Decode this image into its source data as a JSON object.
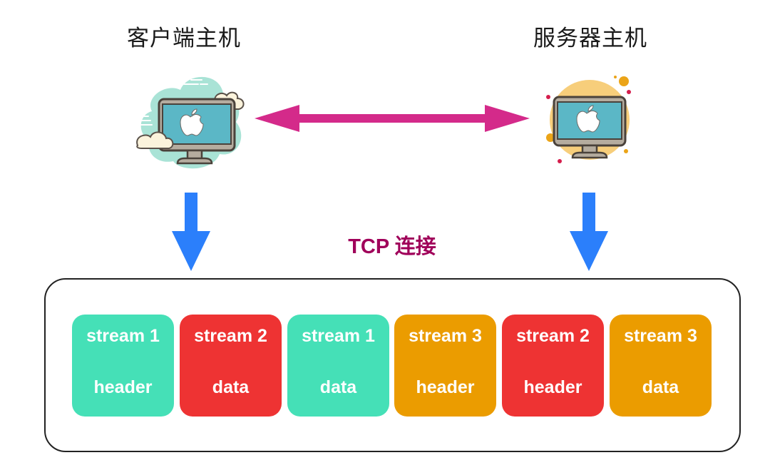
{
  "client": {
    "title": "客户端主机",
    "icon": "client-computer-cloud-icon"
  },
  "server": {
    "title": "服务器主机",
    "icon": "server-computer-circle-icon"
  },
  "connection": {
    "label": "TCP 连接",
    "arrow": "bidirectional-arrow-icon",
    "down_arrow": "down-arrow-icon"
  },
  "colors": {
    "link_arrow": "#D42A8A",
    "down_arrow": "#2B7FFB",
    "tcp_label": "#A0005A",
    "stream_1": "#45E0B7",
    "stream_2": "#EE3333",
    "stream_3": "#EB9C00"
  },
  "frames": [
    {
      "stream": "stream 1",
      "type": "header",
      "color": "#45E0B7"
    },
    {
      "stream": "stream 2",
      "type": "data",
      "color": "#EE3333"
    },
    {
      "stream": "stream 1",
      "type": "data",
      "color": "#45E0B7"
    },
    {
      "stream": "stream 3",
      "type": "header",
      "color": "#EB9C00"
    },
    {
      "stream": "stream 2",
      "type": "header",
      "color": "#EE3333"
    },
    {
      "stream": "stream 3",
      "type": "data",
      "color": "#EB9C00"
    }
  ]
}
